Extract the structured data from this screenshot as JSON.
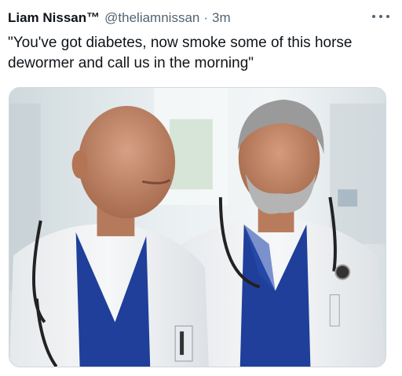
{
  "tweet": {
    "display_name": "Liam Nissan™",
    "handle": "@theliamnissan",
    "separator": "·",
    "time": "3m",
    "text": "\"You've got diabetes, now smoke some of this horse dewormer and call us in the morning\""
  },
  "icons": {
    "more": "more-horizontal-icon"
  },
  "media": {
    "description": "photo-of-two-doctors-in-white-coats-and-blue-scrubs",
    "colors": {
      "scrubs": "#1f3f9a",
      "coat": "#f2f4f6",
      "skin": "#c98f6f",
      "gray_hair": "#9a9a9a",
      "background": "#dfe7ea"
    }
  }
}
